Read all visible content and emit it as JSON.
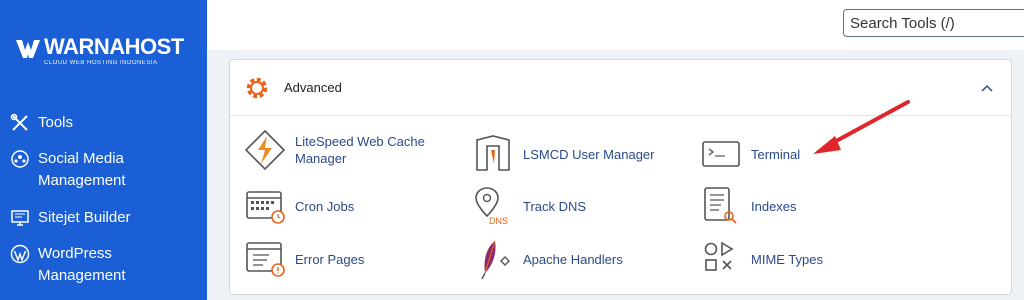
{
  "sidebar": {
    "brand_name": "WARNAHOST",
    "brand_tagline": "CLOUD WEB HOSTING INDONESIA",
    "items": [
      {
        "label": "Tools",
        "icon": "tools-icon"
      },
      {
        "label": "Social Media Management",
        "icon": "social-network-icon"
      },
      {
        "label": "Sitejet Builder",
        "icon": "monitor-icon"
      },
      {
        "label": "WordPress Management",
        "icon": "wordpress-icon"
      }
    ]
  },
  "search": {
    "placeholder": "Search Tools (/)"
  },
  "panel": {
    "title": "Advanced",
    "tools": [
      {
        "label": "LiteSpeed Web Cache Manager",
        "icon": "litespeed-icon"
      },
      {
        "label": "LSMCD User Manager",
        "icon": "lsmcd-icon"
      },
      {
        "label": "Terminal",
        "icon": "terminal-icon"
      },
      {
        "label": "Cron Jobs",
        "icon": "cron-calendar-icon"
      },
      {
        "label": "Track DNS",
        "icon": "dns-pin-icon"
      },
      {
        "label": "Indexes",
        "icon": "indexes-icon"
      },
      {
        "label": "Error Pages",
        "icon": "error-page-icon"
      },
      {
        "label": "Apache Handlers",
        "icon": "feather-icon"
      },
      {
        "label": "MIME Types",
        "icon": "mime-shapes-icon"
      }
    ]
  },
  "colors": {
    "sidebar": "#1a5fd6",
    "link": "#2a4a8a",
    "accent_orange": "#e8631c",
    "arrow_red": "#e0262a"
  }
}
